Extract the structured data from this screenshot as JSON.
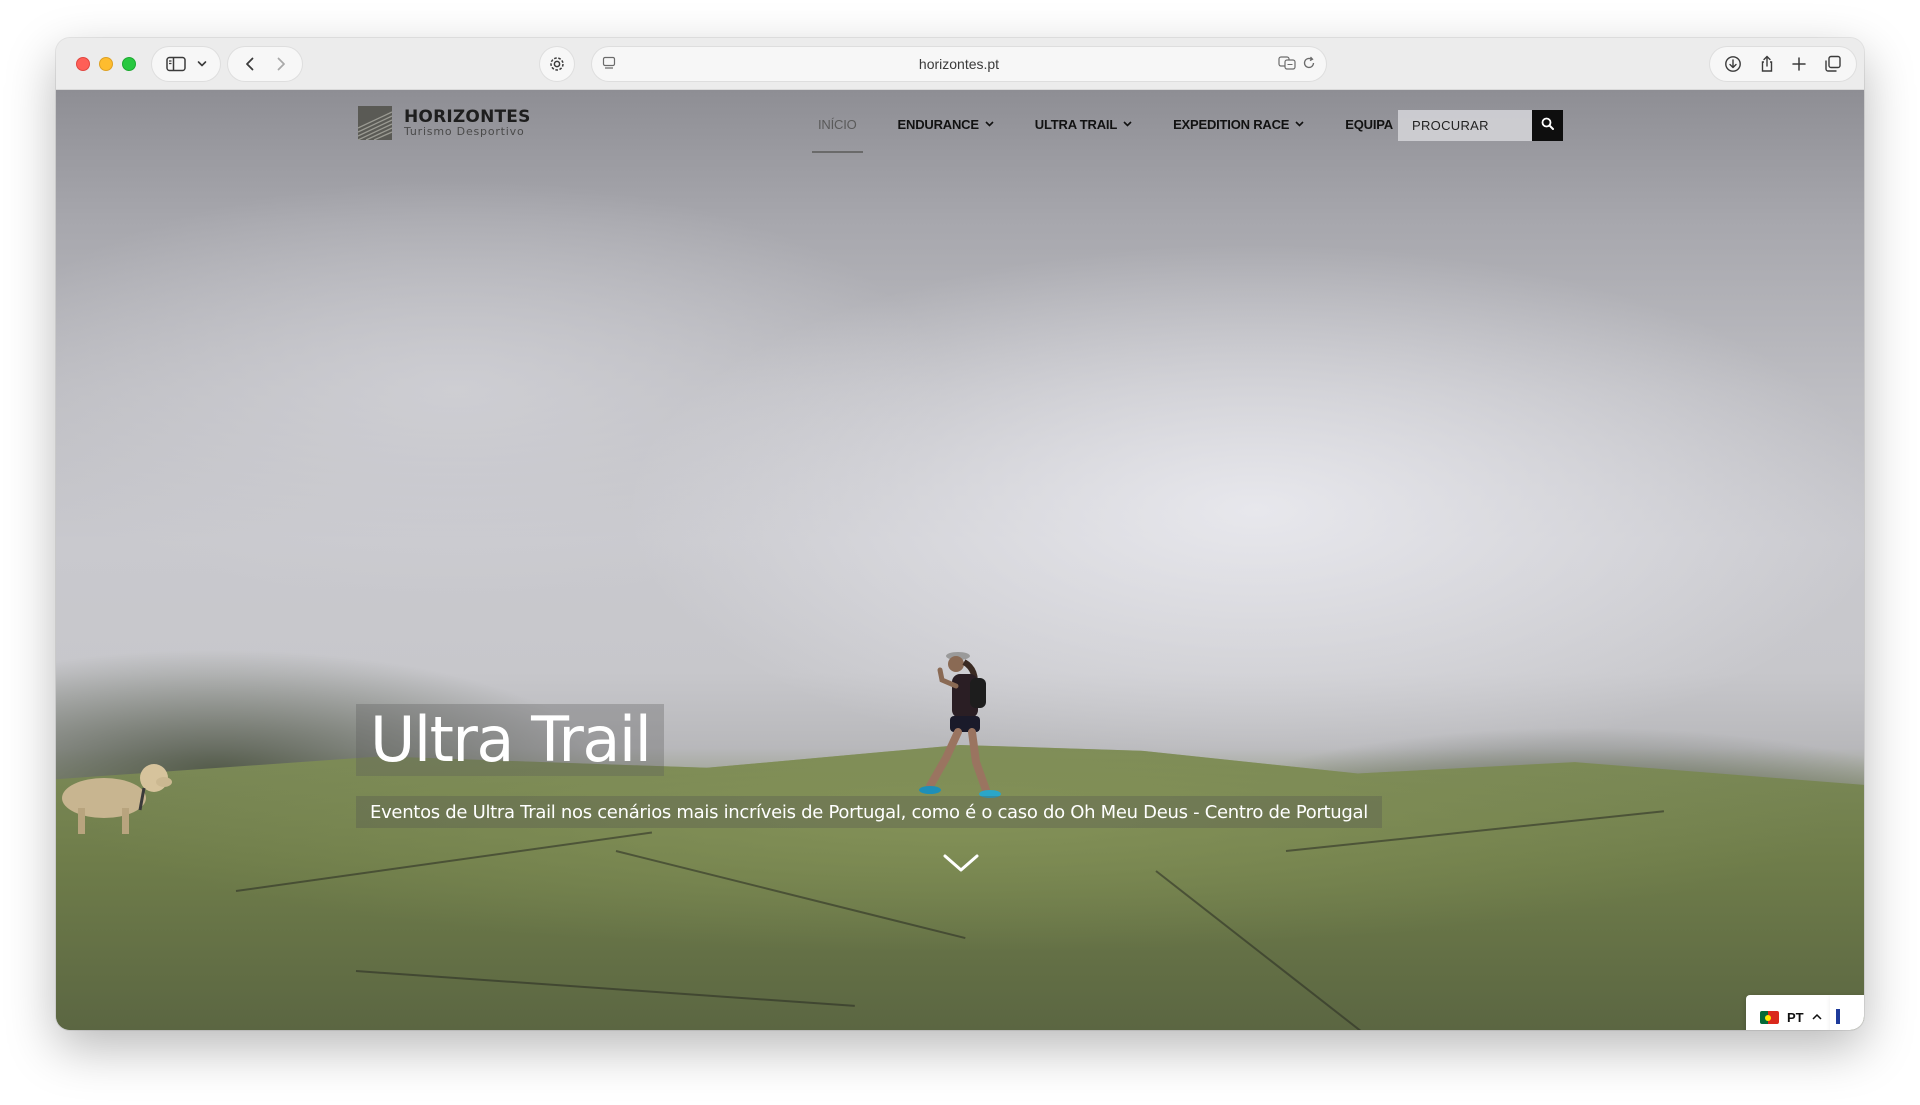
{
  "browser": {
    "url": "horizontes.pt"
  },
  "site": {
    "logo": {
      "name": "HORIZONTES",
      "tagline": "Turismo Desportivo"
    },
    "nav": [
      {
        "label": "INÍCIO",
        "active": true,
        "has_dropdown": false
      },
      {
        "label": "ENDURANCE",
        "active": false,
        "has_dropdown": true
      },
      {
        "label": "ULTRA TRAIL",
        "active": false,
        "has_dropdown": true
      },
      {
        "label": "EXPEDITION RACE",
        "active": false,
        "has_dropdown": true
      },
      {
        "label": "EQUIPA",
        "active": false,
        "has_dropdown": false
      }
    ],
    "search": {
      "placeholder": "PROCURAR"
    }
  },
  "hero": {
    "title": "Ultra Trail",
    "subtitle": "Eventos de Ultra Trail nos cenários mais incríveis de Portugal, como é o caso do Oh Meu Deus - Centro de Portugal"
  },
  "language": {
    "code": "PT",
    "flag": "portugal-flag"
  }
}
